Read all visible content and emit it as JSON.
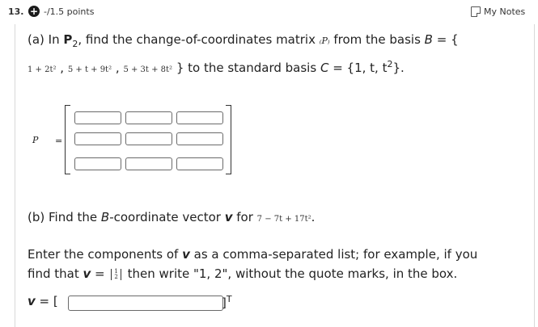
{
  "header": {
    "question_number": "13.",
    "points": "-/1.5 points",
    "notes_label": "My Notes",
    "plus_symbol": "+"
  },
  "part_a": {
    "line1_prefix": "(a) In ",
    "p2": "P",
    "p2_sub": "2",
    "line1_mid": ", find the change-of-coordinates matrix",
    "matrix_symbol": "₍P₎",
    "line1_from": " from the basis ",
    "basis_b": "B",
    "eq_open": " = {",
    "basis_elements": [
      "1 + 2t²",
      "5 + t + 9t²",
      "5 + 3t + 8t²"
    ],
    "sep": ",",
    "line2_suffix": "} to the standard basis ",
    "basis_c": "C",
    "c_set": " = {1, t, t",
    "c_sup": "2",
    "c_close": "}.",
    "matrix_label": "P",
    "matrix_eq": "="
  },
  "part_b": {
    "prefix": "(b) Find the ",
    "b": "B",
    "mid": "-coordinate vector ",
    "v": "v",
    "for": " for ",
    "poly": "7 − 7t + 17t²",
    "end": "."
  },
  "instructions": {
    "line1_a": "Enter the components of ",
    "line1_v": "v",
    "line1_b": " as a comma-separated list; for example, if you",
    "line2_a": "find that ",
    "line2_v": "v",
    "line2_eq": " = ",
    "vec_top": "1",
    "vec_bottom": "2",
    "line2_b": " then write \"1, 2\", without the quote marks, in the box."
  },
  "answer": {
    "v": "v",
    "eq_open": " = [",
    "close": "]",
    "transpose": "T",
    "value": ""
  }
}
